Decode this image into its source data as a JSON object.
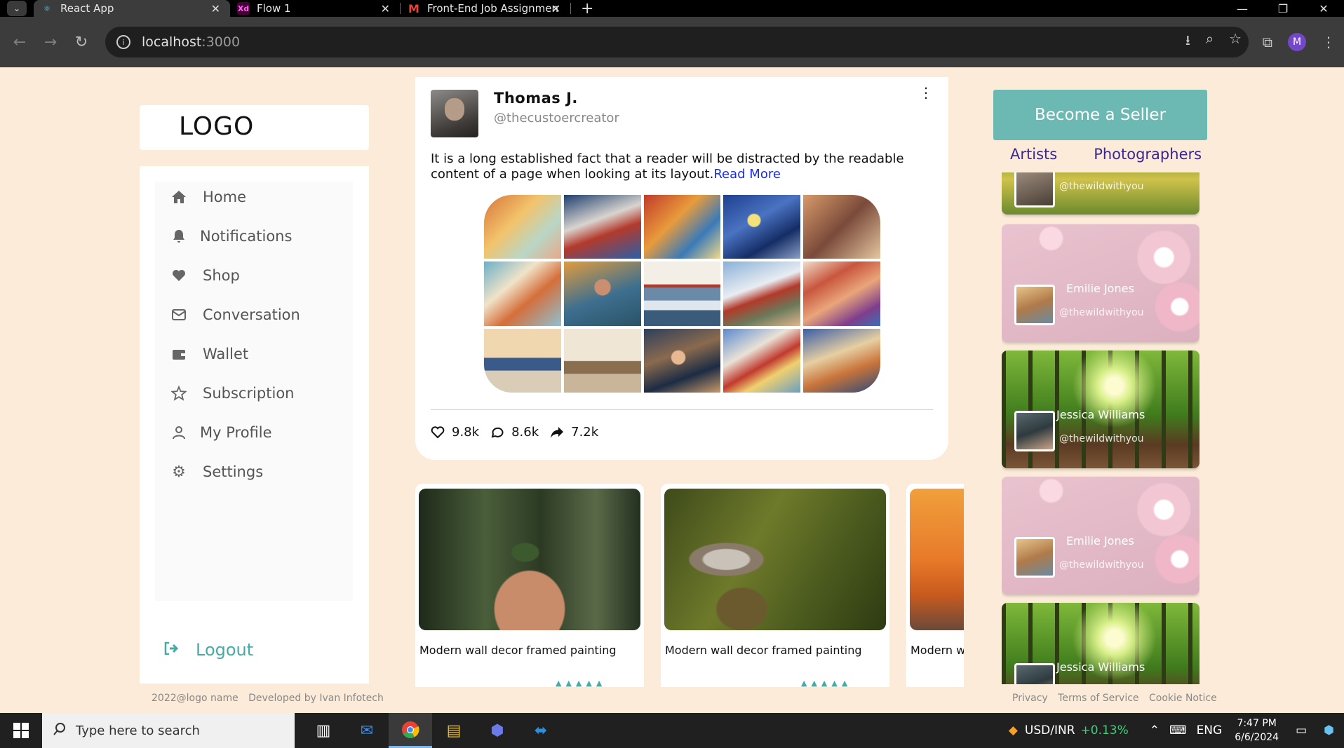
{
  "browser": {
    "tabs": [
      {
        "title": "React App",
        "icon": "react-icon",
        "active": true
      },
      {
        "title": "Flow 1",
        "icon": "xd-icon",
        "active": false
      },
      {
        "title": "Front-End Job Assignment - Re",
        "icon": "gmail-icon",
        "active": false
      }
    ],
    "url_host": "localhost",
    "url_port": ":3000",
    "profile_initial": "M"
  },
  "sidebar": {
    "logo": "LOGO",
    "items": [
      {
        "label": "Home",
        "icon": "home-icon"
      },
      {
        "label": "Notifications",
        "icon": "bell-icon"
      },
      {
        "label": "Shop",
        "icon": "heart-icon"
      },
      {
        "label": "Conversation",
        "icon": "mail-icon"
      },
      {
        "label": "Wallet",
        "icon": "wallet-icon"
      },
      {
        "label": "Subscription",
        "icon": "star-icon"
      },
      {
        "label": "My Profile",
        "icon": "user-icon"
      },
      {
        "label": "Settings",
        "icon": "gear-icon"
      }
    ],
    "logout": "Logout"
  },
  "post": {
    "name": "Thomas J.",
    "handle": "@thecustoercreator",
    "text": "It is a long established fact that a reader will be distracted by the readable content of a page when looking at its layout.",
    "read_more": "Read More",
    "likes": "9.8k",
    "comments": "8.6k",
    "shares": "7.2k"
  },
  "products": [
    {
      "title": "Modern wall decor framed painting"
    },
    {
      "title": "Modern wall decor framed painting"
    },
    {
      "title": "Modern w"
    }
  ],
  "right": {
    "seller_button": "Become a Seller",
    "tab_artists": "Artists",
    "tab_photographers": "Photographers",
    "creators": [
      {
        "name": "",
        "handle": "@thewildwithyou"
      },
      {
        "name": "Emilie Jones",
        "handle": "@thewildwithyou"
      },
      {
        "name": "Jessica Williams",
        "handle": "@thewildwithyou"
      },
      {
        "name": "Emilie Jones",
        "handle": "@thewildwithyou"
      },
      {
        "name": "Jessica Williams",
        "handle": ""
      }
    ]
  },
  "footer": {
    "copyright": "2022@logo name",
    "developer": "Developed by Ivan Infotech",
    "privacy": "Privacy",
    "terms": "Terms of Service",
    "cookie": "Cookie Notice"
  },
  "taskbar": {
    "search_placeholder": "Type here to search",
    "ticker": "USD/INR",
    "ticker_change": "+0.13%",
    "language": "ENG",
    "time": "7:47 PM",
    "date": "6/6/2024"
  },
  "colors": {
    "page_bg": "#fbebd8",
    "accent": "#48aaa6",
    "seller_button": "#6cb8b3",
    "tab_text": "#3a2790",
    "link": "#1b2ee0"
  }
}
